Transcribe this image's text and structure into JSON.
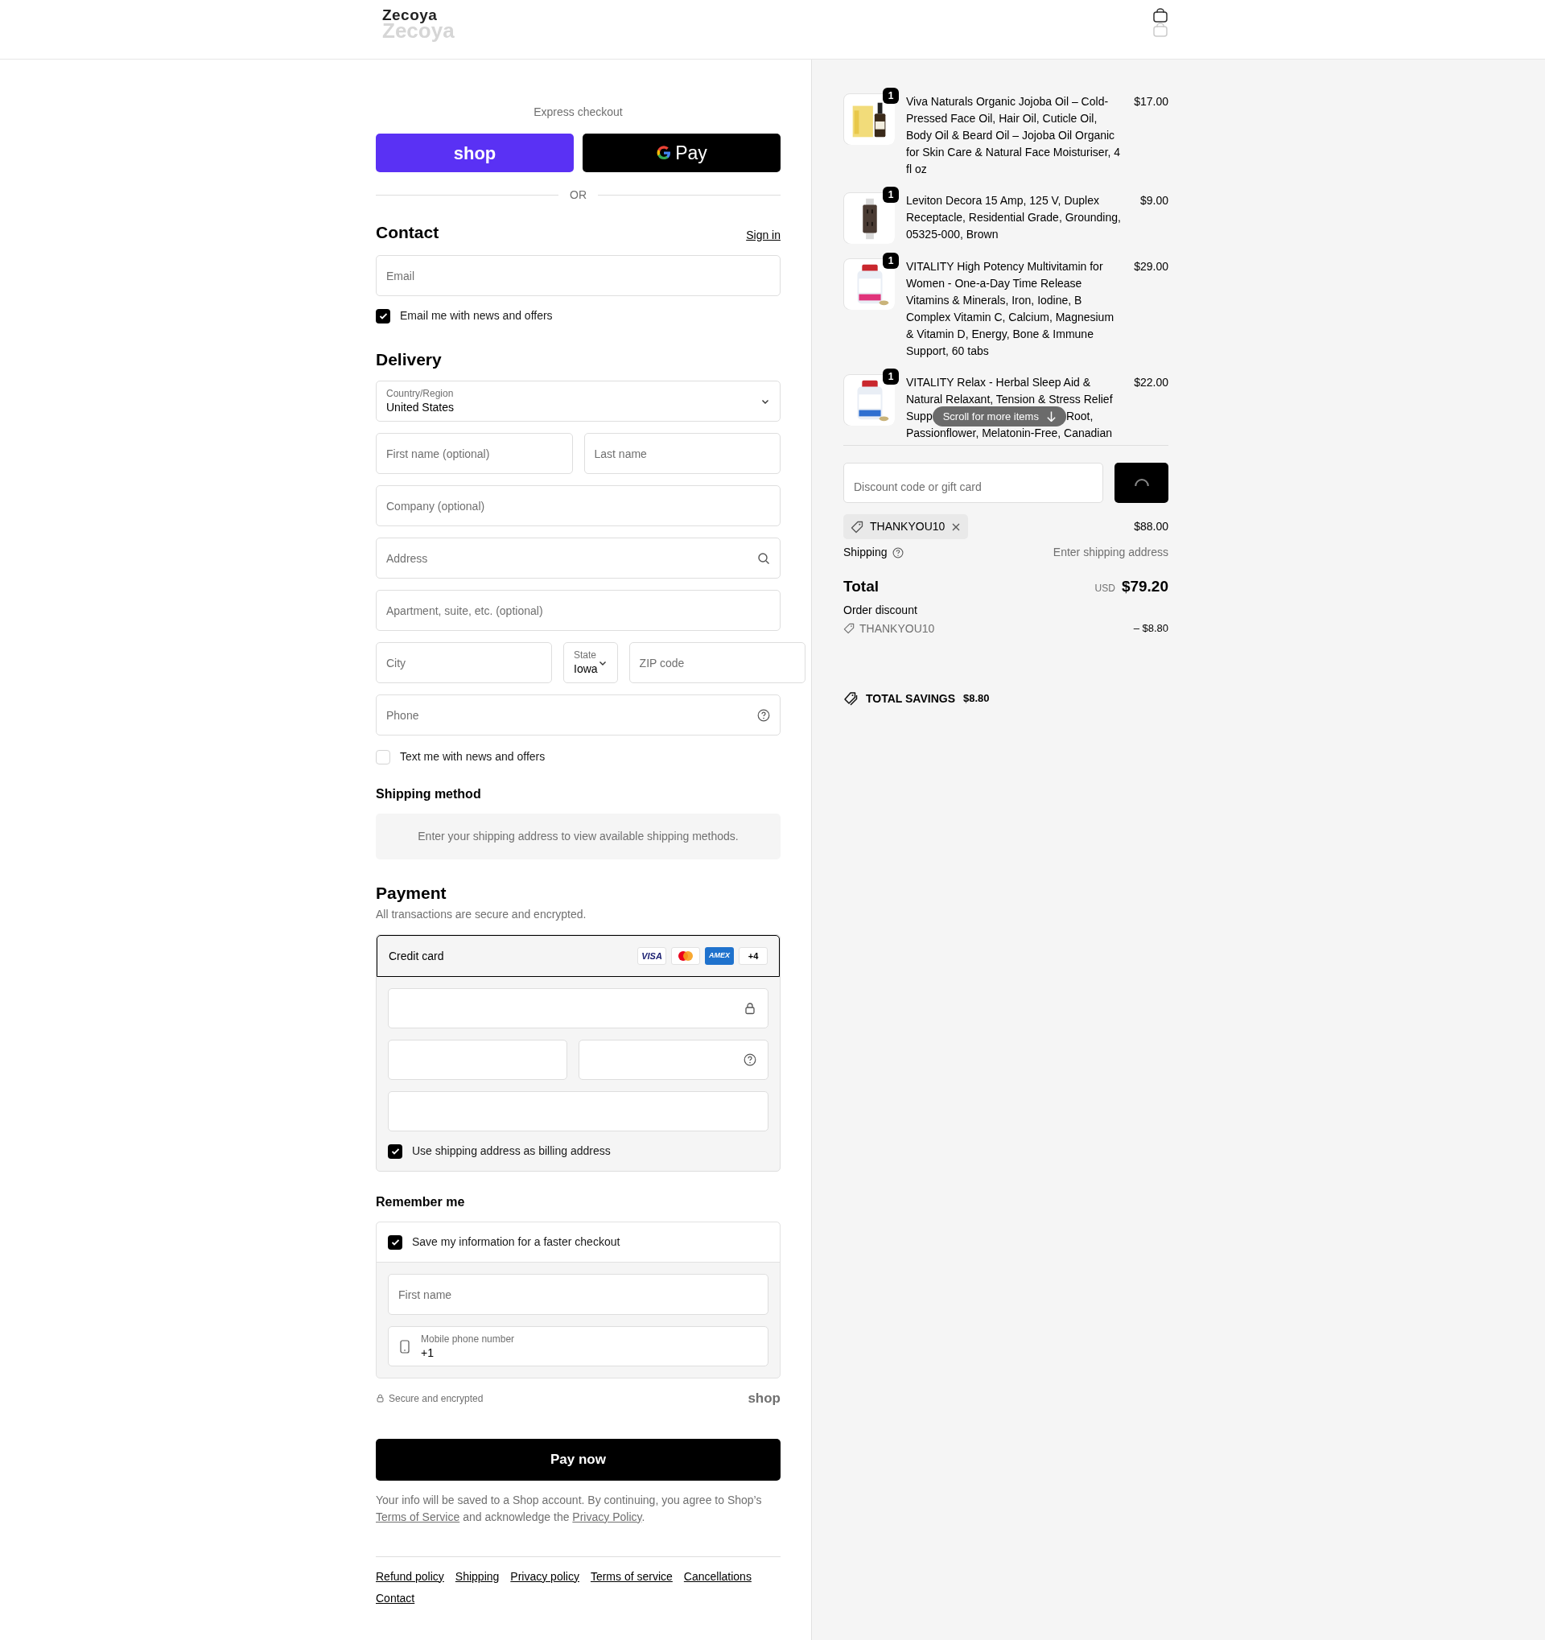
{
  "header": {
    "logo": "Zecoya",
    "logo_reflection": "Zecoya"
  },
  "express": {
    "title": "Express checkout",
    "buttons": [
      {
        "kind": "shop",
        "label": "shop"
      },
      {
        "kind": "gpay",
        "label": "Pay"
      }
    ],
    "divider": "OR"
  },
  "contact": {
    "heading": "Contact",
    "sign_in": "Sign in",
    "email": {
      "placeholder": "Email"
    },
    "newsletter": {
      "label": "Email me with news and offers",
      "checked": true
    }
  },
  "delivery": {
    "heading": "Delivery",
    "rows": [
      [
        {
          "kind": "select",
          "label": "Country/Region",
          "value": "United States"
        }
      ],
      [
        {
          "kind": "input",
          "placeholder": "First name (optional)"
        },
        {
          "kind": "input",
          "placeholder": "Last name"
        }
      ],
      [
        {
          "kind": "input",
          "placeholder": "Company (optional)"
        }
      ],
      [
        {
          "kind": "search_input",
          "placeholder": "Address"
        }
      ],
      [
        {
          "kind": "input",
          "placeholder": "Apartment, suite, etc. (optional)"
        }
      ],
      [
        {
          "kind": "input",
          "placeholder": "City"
        },
        {
          "kind": "select",
          "label": "State",
          "value": "Iowa"
        },
        {
          "kind": "input",
          "placeholder": "ZIP code"
        }
      ],
      [
        {
          "kind": "help_input",
          "placeholder": "Phone"
        }
      ]
    ],
    "sms": {
      "label": "Text me with news and offers",
      "checked": false
    }
  },
  "shipping_method": {
    "heading": "Shipping method",
    "notice": "Enter your shipping address to view available shipping methods."
  },
  "payment": {
    "heading": "Payment",
    "subtitle": "All transactions are secure and encrypted.",
    "method": {
      "label": "Credit card",
      "selected": true,
      "brands": [
        {
          "kind": "visa",
          "label": "VISA"
        },
        {
          "kind": "mastercard"
        },
        {
          "kind": "amex",
          "label": "AMEX"
        },
        {
          "kind": "more",
          "label": "+4"
        }
      ]
    },
    "billing": {
      "label": "Use shipping address as billing address",
      "checked": true
    }
  },
  "remember": {
    "heading": "Remember me",
    "save": {
      "label": "Save my information for a faster checkout",
      "checked": true
    },
    "first_name": {
      "placeholder": "First name"
    },
    "phone": {
      "label": "Mobile phone number",
      "value": "+1"
    },
    "secure": "Secure and encrypted",
    "shop_logo": "shop"
  },
  "pay_button": "Pay now",
  "legal": [
    {
      "text": "Your info will be saved to a Shop account. By continuing, you agree to Shop’s "
    },
    {
      "link": "Terms of Service"
    },
    {
      "text": " and acknowledge the "
    },
    {
      "link": "Privacy Policy"
    },
    {
      "text": "."
    }
  ],
  "footer_links": [
    "Refund policy",
    "Shipping",
    "Privacy policy",
    "Terms of service",
    "Cancellations",
    "Contact"
  ],
  "summary": {
    "items": [
      {
        "title": "Viva Naturals Organic Jojoba Oil – Cold-Pressed Face Oil, Hair Oil, Cuticle Oil, Body Oil & Beard Oil – Jojoba Oil Organic for Skin Care & Natural Face Moisturiser, 4 fl oz",
        "price": "$17.00",
        "quantity": "1",
        "kind": "bottle"
      },
      {
        "title": "Leviton Decora 15 Amp, 125 V, Duplex Receptacle, Residential Grade, Grounding, 05325-000, Brown",
        "price": "$9.00",
        "quantity": "1",
        "kind": "outlet"
      },
      {
        "title": "VITALITY High Potency Multivitamin for Women - One-a-Day Time Release Vitamins & Minerals, Iron, Iodine, B Complex Vitamin C, Calcium, Magnesium & Vitamin D, Energy, Bone & Immune Support, 60 tabs",
        "price": "$29.00",
        "quantity": "1",
        "kind": "jar_pink"
      },
      {
        "title_lines": [
          [
            "VITALITY Relax - Herbal Sleep Aid &"
          ],
          [
            "Natural Relaxant, Tension & Stress Relief"
          ],
          [
            "Supp",
            "Root,"
          ],
          [
            "Passionflower, Melatonin-Free, Canadian"
          ]
        ],
        "price": "$22.00",
        "quantity": "1",
        "kind": "jar_blue"
      }
    ],
    "scroll_hint": "Scroll for more items",
    "discount": {
      "placeholder": "Discount code or gift card"
    },
    "applied_code": "THANKYOU10",
    "subtotal": "$88.00",
    "shipping": {
      "label": "Shipping",
      "value": "Enter shipping address"
    },
    "total": {
      "label": "Total",
      "currency": "USD",
      "value": "$79.20"
    },
    "order_discount": {
      "label": "Order discount",
      "code": "THANKYOU10",
      "amount": "– $8.80"
    },
    "savings": {
      "label": "TOTAL SAVINGS",
      "value": "$8.80"
    }
  }
}
